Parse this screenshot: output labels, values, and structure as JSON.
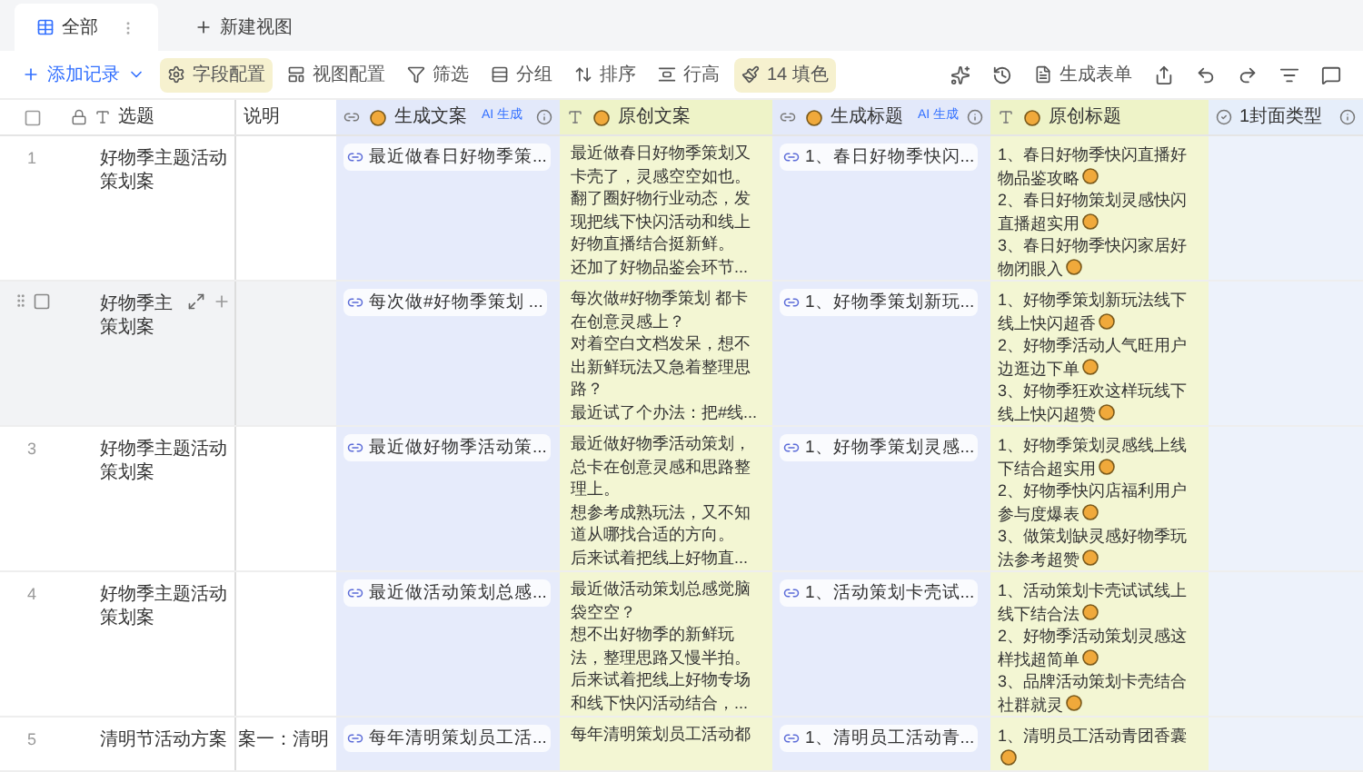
{
  "tabs": [
    {
      "label": "全部",
      "selected": true
    },
    {
      "label": "新建视图",
      "selected": false
    }
  ],
  "toolbar": {
    "add": "添加记录",
    "items": [
      {
        "label": "字段配置",
        "highlighted": true
      },
      {
        "label": "视图配置",
        "highlighted": false
      },
      {
        "label": "筛选",
        "highlighted": false
      },
      {
        "label": "分组",
        "highlighted": false
      },
      {
        "label": "排序",
        "highlighted": false
      },
      {
        "label": "行高",
        "highlighted": false
      },
      {
        "label": "14 填色",
        "highlighted": true
      }
    ],
    "form": "生成表单"
  },
  "select_all": {
    "checked": false
  },
  "columns": [
    {
      "label": "选题",
      "kind": "title",
      "ai": false
    },
    {
      "label": "说明",
      "kind": "text",
      "ai": false
    },
    {
      "label": "生成文案",
      "kind": "generated",
      "ai": true,
      "badge": "AI 生成"
    },
    {
      "label": "原创文案",
      "kind": "original",
      "ai": false
    },
    {
      "label": "生成标题",
      "kind": "generated",
      "ai": true,
      "badge": "AI 生成"
    },
    {
      "label": "原创标题",
      "kind": "original",
      "ai": false
    },
    {
      "label": "1封面类型",
      "kind": "select",
      "ai": false
    }
  ],
  "rows": [
    {
      "number": "1",
      "hovered": false,
      "title": "好物季主题活动策划案",
      "description": "",
      "gen_copy": "最近做春日好物季策...",
      "orig_copy": [
        "最近做春日好物季策划又卡壳了，灵感空空如也。",
        "翻了圈好物行业动态，发现把线下快闪活动和线上好物直播结合挺新鲜。",
        "还加了好物品鉴会环节..."
      ],
      "gen_title": "1、春日好物季快闪...",
      "orig_title": [
        "1、春日好物季快闪直播好物品鉴攻略",
        "2、春日好物策划灵感快闪直播超实用",
        "3、春日好物季快闪家居好物闭眼入"
      ]
    },
    {
      "hovered": true,
      "checked": false,
      "title": "好物季主策划案",
      "description": "",
      "gen_copy": "每次做#好物季策划 ...",
      "orig_copy": [
        "每次做#好物季策划 都卡在创意灵感上？",
        "对着空白文档发呆，想不出新鲜玩法又急着整理思路？",
        "最近试了个办法：把#线..."
      ],
      "gen_title": "1、好物季策划新玩...",
      "orig_title": [
        "1、好物季策划新玩法线下线上快闪超香",
        "2、好物季活动人气旺用户边逛边下单",
        "3、好物季狂欢这样玩线下线上快闪超赞"
      ]
    },
    {
      "number": "3",
      "hovered": false,
      "title": "好物季主题活动策划案",
      "description": "",
      "gen_copy": "最近做好物季活动策...",
      "orig_copy": [
        "最近做好物季活动策划，总卡在创意灵感和思路整理上。",
        "想参考成熟玩法，又不知道从哪找合适的方向。",
        "后来试着把线上好物直..."
      ],
      "gen_title": "1、好物季策划灵感...",
      "orig_title": [
        "1、好物季策划灵感线上线下结合超实用",
        "2、好物季快闪店福利用户参与度爆表",
        "3、做策划缺灵感好物季玩法参考超赞"
      ]
    },
    {
      "number": "4",
      "hovered": false,
      "title": "好物季主题活动策划案",
      "description": "",
      "gen_copy": "最近做活动策划总感...",
      "orig_copy": [
        "最近做活动策划总感觉脑袋空空？",
        "想不出好物季的新鲜玩法，整理思路又慢半拍。",
        "后来试着把线上好物专场和线下快闪活动结合，..."
      ],
      "gen_title": "1、活动策划卡壳试...",
      "orig_title": [
        "1、活动策划卡壳试试线上线下结合法",
        "2、好物季活动策划灵感这样找超简单",
        "3、品牌活动策划卡壳结合社群就灵"
      ]
    },
    {
      "number": "5",
      "hovered": false,
      "title": "清明节活动方案",
      "description": "案一：清明",
      "gen_copy": "每年清明策划员工活...",
      "orig_copy": [
        "每年清明策划员工活动都"
      ],
      "gen_title": "1、清明员工活动青...",
      "orig_title": [
        "1、清明员工活动青团香囊"
      ]
    }
  ]
}
